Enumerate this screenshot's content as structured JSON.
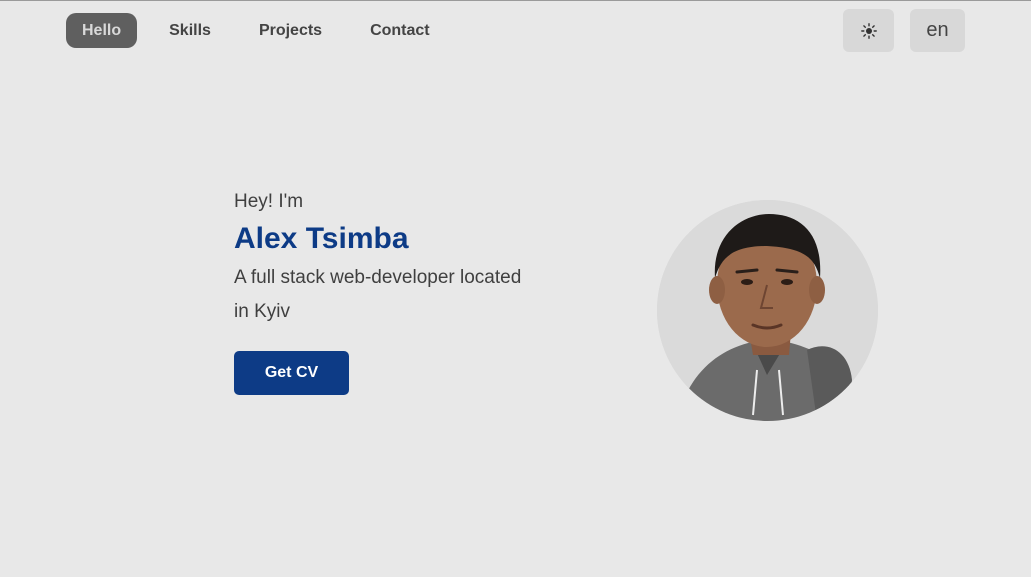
{
  "nav": {
    "items": [
      {
        "label": "Hello",
        "active": true
      },
      {
        "label": "Skills",
        "active": false
      },
      {
        "label": "Projects",
        "active": false
      },
      {
        "label": "Contact",
        "active": false
      }
    ]
  },
  "controls": {
    "theme_icon": "sun-icon",
    "language": "en"
  },
  "hero": {
    "greeting": "Hey! I'm",
    "name": "Alex Tsimba",
    "tagline": "A full stack web-developer located in Kyiv",
    "cv_button": "Get CV"
  },
  "colors": {
    "background": "#e8e8e8",
    "accent": "#0d3b86",
    "active_nav": "#5f5f5f"
  }
}
